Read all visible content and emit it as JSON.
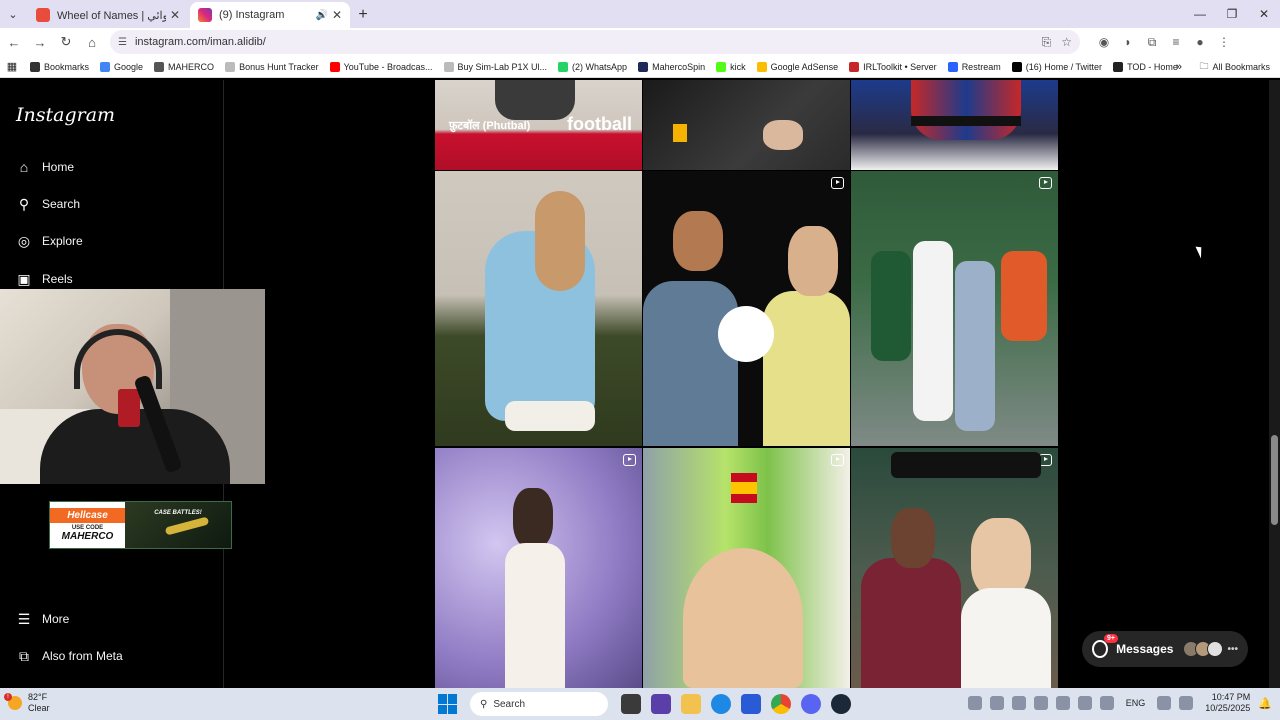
{
  "browser": {
    "tabs": [
      {
        "title": "Wheel of Names | عجلة العشوائي...",
        "active": false,
        "favicon_color": "#e84c3d"
      },
      {
        "title": "(9) Instagram",
        "active": true,
        "favicon_color": "#d6249f"
      }
    ],
    "url": "instagram.com/iman.alidib/",
    "bookmarks": [
      {
        "label": "Bookmarks",
        "color": "#333333"
      },
      {
        "label": "Google",
        "color": "#4285f4"
      },
      {
        "label": "MAHERCO",
        "color": "#555555"
      },
      {
        "label": "Bonus Hunt Tracker",
        "color": "#bbbbbb"
      },
      {
        "label": "YouTube - Broadcas...",
        "color": "#ff0000"
      },
      {
        "label": "Buy Sim-Lab P1X Ul...",
        "color": "#bbbbbb"
      },
      {
        "label": "(2) WhatsApp",
        "color": "#25d366"
      },
      {
        "label": "MahercoSpin",
        "color": "#1e2a5a"
      },
      {
        "label": "kick",
        "color": "#53fc18"
      },
      {
        "label": "Google AdSense",
        "color": "#fbbc04"
      },
      {
        "label": "IRLToolkit • Server",
        "color": "#c62828"
      },
      {
        "label": "Restream",
        "color": "#2962ff"
      },
      {
        "label": "(16) Home / Twitter",
        "color": "#000000"
      },
      {
        "label": "TOD - Home",
        "color": "#222222"
      }
    ],
    "all_bookmarks": "All Bookmarks"
  },
  "instagram": {
    "logo": "Instagram",
    "nav": [
      {
        "label": "Home",
        "icon": "home-icon"
      },
      {
        "label": "Search",
        "icon": "search-icon"
      },
      {
        "label": "Explore",
        "icon": "compass-icon"
      },
      {
        "label": "Reels",
        "icon": "reels-icon"
      }
    ],
    "nav_bottom": [
      {
        "label": "More",
        "icon": "menu-icon"
      },
      {
        "label": "Also from Meta",
        "icon": "meta-icon"
      }
    ],
    "posts": {
      "top_text_1": "फ़ुटबॉल (Phutbal)",
      "top_text_2": "football"
    },
    "messages": {
      "label": "Messages",
      "badge": "9+"
    }
  },
  "overlay": {
    "hellcase_brand": "Hellcase",
    "use_code": "USE CODE",
    "code": "MAHERCO",
    "case_battles": "CASE BATTLES!"
  },
  "taskbar": {
    "temp": "82°F",
    "condition": "Clear",
    "alert_badge": "!",
    "search": "Search",
    "lang": "ENG",
    "time": "10:47 PM",
    "date": "10/25/2025"
  }
}
